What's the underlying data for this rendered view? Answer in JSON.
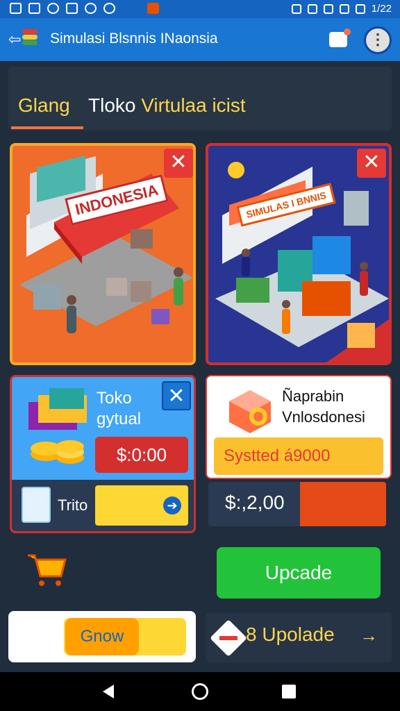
{
  "app": {
    "title": "Simulasi Blsnnis INaonsia"
  },
  "status_bar": {
    "time": "1/22"
  },
  "tabs": [
    {
      "label": "Glang",
      "active": true
    },
    {
      "label": "Tloko",
      "label_accent": "Virtulaa icist",
      "active": false
    }
  ],
  "cards": {
    "shop_indonesia": {
      "sign_text": "INDONESIA"
    },
    "sim_store": {
      "sign_text": "SIMULAS I BNNIS"
    },
    "toko_virtual": {
      "title_line1": "Toko",
      "title_line2": "gytual",
      "price": "$:0:00",
      "footer_label": "Trito"
    },
    "napprabin": {
      "title_line1": "Ñaprabin",
      "title_line2": "Vnlosdonesi",
      "system_label": "Systted á9000"
    },
    "balance": {
      "amount": "$:,2,00"
    }
  },
  "buttons": {
    "upgrade": "Upcade",
    "grow": "Gnow",
    "upload": "Upolade",
    "upload_prefix": "8"
  },
  "colors": {
    "appbar": "#1976d2",
    "accent_yellow": "#ffd54f",
    "close_red": "#e53935",
    "close_blue": "#1976d2",
    "upgrade_green": "#22c33a"
  }
}
